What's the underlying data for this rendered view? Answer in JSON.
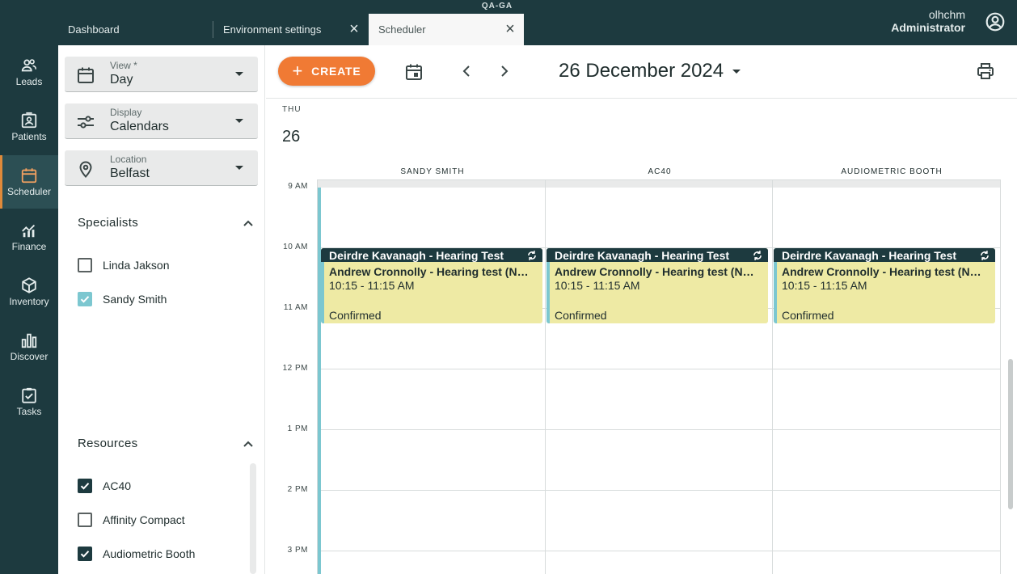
{
  "environment": "QA-GA",
  "tabs": [
    {
      "label": "Dashboard"
    },
    {
      "label": "Environment settings"
    },
    {
      "label": "Scheduler"
    }
  ],
  "user": {
    "name": "olhchm",
    "role": "Administrator"
  },
  "nav": [
    {
      "label": "Leads",
      "icon": "people-icon"
    },
    {
      "label": "Patients",
      "icon": "patient-card-icon"
    },
    {
      "label": "Scheduler",
      "icon": "calendar-icon"
    },
    {
      "label": "Finance",
      "icon": "finance-icon"
    },
    {
      "label": "Inventory",
      "icon": "box-icon"
    },
    {
      "label": "Discover",
      "icon": "bar-chart-icon"
    },
    {
      "label": "Tasks",
      "icon": "clipboard-check-icon"
    }
  ],
  "filters": {
    "view": {
      "label": "View *",
      "value": "Day"
    },
    "display": {
      "label": "Display",
      "value": "Calendars"
    },
    "location": {
      "label": "Location",
      "value": "Belfast"
    },
    "specialists_title": "Specialists",
    "specialists": [
      {
        "label": "Linda Jakson",
        "checked": false
      },
      {
        "label": "Sandy Smith",
        "checked": true
      }
    ],
    "resources_title": "Resources",
    "resources": [
      {
        "label": "AC40",
        "checked": true
      },
      {
        "label": "Affinity Compact",
        "checked": false
      },
      {
        "label": "Audiometric Booth",
        "checked": true
      }
    ]
  },
  "toolbar": {
    "create_label": "CREATE",
    "date_title": "26 December 2024"
  },
  "day": {
    "dow": "THU",
    "num": "26"
  },
  "columns": [
    "SANDY SMITH",
    "AC40",
    "AUDIOMETRIC BOOTH"
  ],
  "hours": [
    "9 AM",
    "10 AM",
    "11 AM",
    "12 PM",
    "1 PM",
    "2 PM",
    "3 PM"
  ],
  "events": [
    {
      "title": "Deirdre Kavanagh - Hearing Test",
      "patient": "Andrew Cronnolly - Hearing test (NHS)",
      "time": "10:15 - 11:15 AM",
      "status": "Confirmed"
    },
    {
      "title": "Deirdre Kavanagh - Hearing Test",
      "patient": "Andrew Cronnolly - Hearing test (NHS)",
      "time": "10:15 - 11:15 AM",
      "status": "Confirmed"
    },
    {
      "title": "Deirdre Kavanagh - Hearing Test",
      "patient": "Andrew Cronnolly - Hearing test (NHS)",
      "time": "10:15 - 11:15 AM",
      "status": "Confirmed"
    }
  ],
  "colors": {
    "brand_dark": "#1d3a3f",
    "accent": "#f07a34",
    "event_bg": "#eeeaa4",
    "event_bar": "#7cc7d0"
  }
}
